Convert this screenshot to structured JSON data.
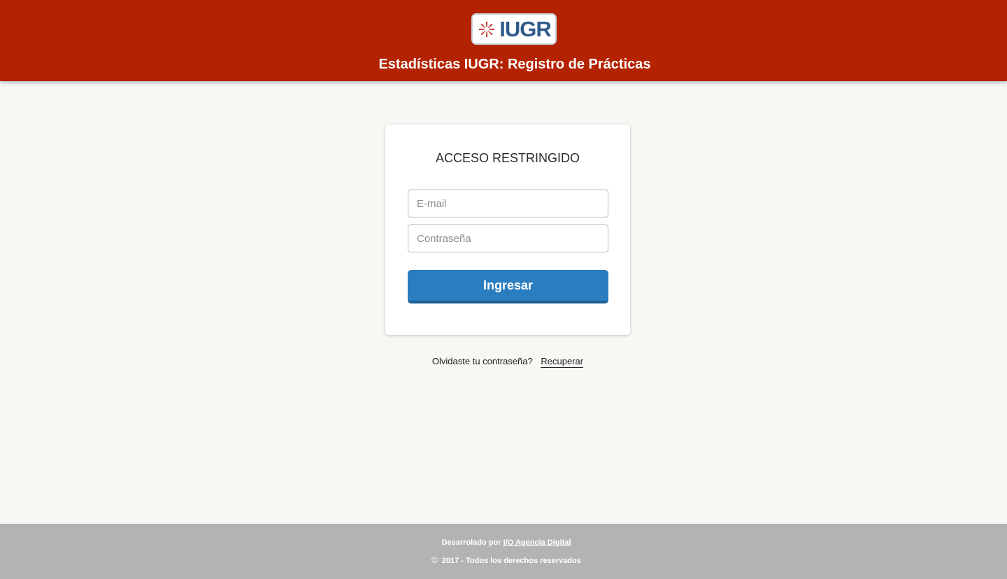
{
  "header": {
    "logo_text": "IUGR",
    "title": "Estadísticas IUGR: Registro de Prácticas"
  },
  "login": {
    "title": "ACCESO RESTRINGIDO",
    "email_placeholder": "E-mail",
    "email_value": "",
    "password_placeholder": "Contraseña",
    "password_value": "",
    "submit_label": "Ingresar"
  },
  "recover": {
    "question": "Olvidaste tu contraseña?",
    "link_label": "Recuperar"
  },
  "footer": {
    "developed_by_prefix": "Desarrolado por",
    "developer_link": "I/O Agencia Digital",
    "copyright_symbol": "©",
    "copyright_text": "2017 - Todos los derechos reservados"
  },
  "icons": {
    "logo_mark": "iugr-sunburst-icon",
    "copyright": "copyright-icon"
  },
  "colors": {
    "header_bg": "#b42301",
    "primary_button": "#2a7dbf",
    "logo_text": "#2f5b8a",
    "footer_bg": "#b3b3b3",
    "page_bg": "#f8f7f4"
  }
}
